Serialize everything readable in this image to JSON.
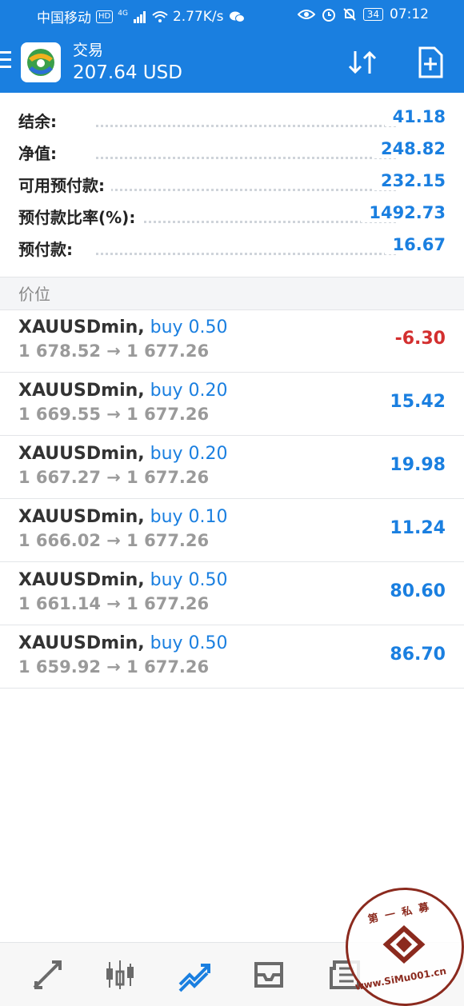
{
  "status_bar": {
    "carrier": "中国移动",
    "hd": "HD",
    "network": "4G",
    "speed": "2.77K/s",
    "battery": "34",
    "time": "07:12"
  },
  "app_bar": {
    "title": "交易",
    "balance_display": "207.64 USD"
  },
  "summary": [
    {
      "label": "结余:",
      "value": "41.18"
    },
    {
      "label": "净值:",
      "value": "248.82"
    },
    {
      "label": "可用预付款:",
      "value": "232.15"
    },
    {
      "label": "预付款比率(%):",
      "value": "1492.73"
    },
    {
      "label": "预付款:",
      "value": "16.67"
    }
  ],
  "section_title": "价位",
  "positions": [
    {
      "symbol": "XAUUSDmin,",
      "type": "buy 0.50",
      "prices": "1 678.52 → 1 677.26",
      "profit": "-6.30",
      "profit_color": "#d32f2f"
    },
    {
      "symbol": "XAUUSDmin,",
      "type": "buy 0.20",
      "prices": "1 669.55 → 1 677.26",
      "profit": "15.42",
      "profit_color": "#1a7fe0"
    },
    {
      "symbol": "XAUUSDmin,",
      "type": "buy 0.20",
      "prices": "1 667.27 → 1 677.26",
      "profit": "19.98",
      "profit_color": "#1a7fe0"
    },
    {
      "symbol": "XAUUSDmin,",
      "type": "buy 0.10",
      "prices": "1 666.02 → 1 677.26",
      "profit": "11.24",
      "profit_color": "#1a7fe0"
    },
    {
      "symbol": "XAUUSDmin,",
      "type": "buy 0.50",
      "prices": "1 661.14 → 1 677.26",
      "profit": "80.60",
      "profit_color": "#1a7fe0"
    },
    {
      "symbol": "XAUUSDmin,",
      "type": "buy 0.50",
      "prices": "1 659.92 → 1 677.26",
      "profit": "86.70",
      "profit_color": "#1a7fe0"
    }
  ],
  "bottom_nav": [
    {
      "name": "quotes-nav",
      "icon": "arrows-diagonal-icon",
      "active": false
    },
    {
      "name": "chart-nav",
      "icon": "candlestick-icon",
      "active": false
    },
    {
      "name": "trade-nav",
      "icon": "trend-icon",
      "active": true
    },
    {
      "name": "history-nav",
      "icon": "inbox-icon",
      "active": false
    },
    {
      "name": "news-nav",
      "icon": "newspaper-icon",
      "active": false
    }
  ],
  "watermark": {
    "top_text": "第 一 私 募",
    "bottom_text": "www.SiMu001.cn"
  },
  "colors": {
    "accent": "#1a7fe0",
    "loss": "#d32f2f",
    "watermark": "#8b2a1e"
  }
}
